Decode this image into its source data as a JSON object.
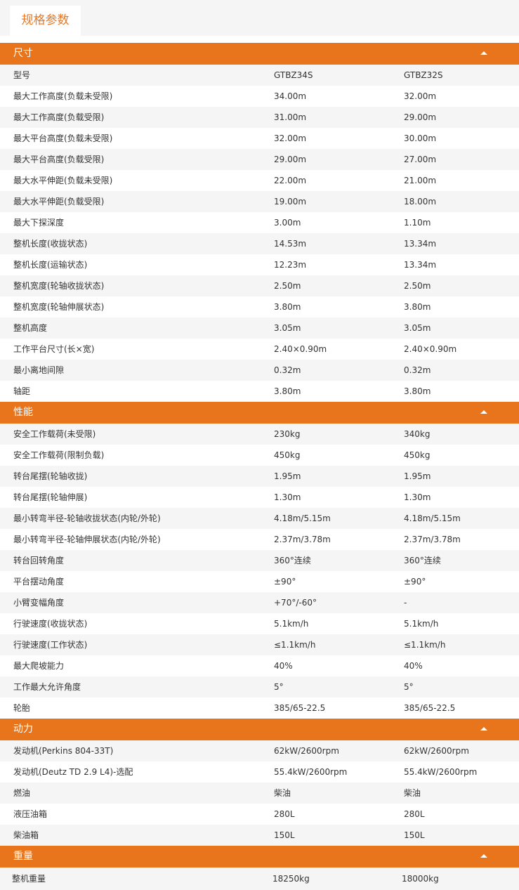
{
  "tab": {
    "label": "规格参数"
  },
  "sections": [
    {
      "title": "尺寸",
      "rows": [
        [
          "型号",
          "GTBZ34S",
          "GTBZ32S"
        ],
        [
          "最大工作高度(负载未受限)",
          "34.00m",
          "32.00m"
        ],
        [
          "最大工作高度(负载受限)",
          "31.00m",
          "29.00m"
        ],
        [
          "最大平台高度(负载未受限)",
          "32.00m",
          "30.00m"
        ],
        [
          "最大平台高度(负载受限)",
          "29.00m",
          "27.00m"
        ],
        [
          "最大水平伸距(负载未受限)",
          "22.00m",
          "21.00m"
        ],
        [
          "最大水平伸距(负载受限)",
          "19.00m",
          "18.00m"
        ],
        [
          "最大下探深度",
          "3.00m",
          "1.10m"
        ],
        [
          "整机长度(收拢状态)",
          "14.53m",
          "13.34m"
        ],
        [
          "整机长度(运输状态)",
          "12.23m",
          "13.34m"
        ],
        [
          "整机宽度(轮轴收拢状态)",
          "2.50m",
          "2.50m"
        ],
        [
          "整机宽度(轮轴伸展状态)",
          "3.80m",
          "3.80m"
        ],
        [
          "整机高度",
          "3.05m",
          "3.05m"
        ],
        [
          "工作平台尺寸(长×宽)",
          "2.40×0.90m",
          "2.40×0.90m"
        ],
        [
          "最小离地间隙",
          "0.32m",
          "0.32m"
        ],
        [
          "轴距",
          "3.80m",
          "3.80m"
        ]
      ]
    },
    {
      "title": "性能",
      "rows": [
        [
          "安全工作载荷(未受限)",
          "230kg",
          "340kg"
        ],
        [
          "安全工作载荷(限制负载)",
          "450kg",
          "450kg"
        ],
        [
          "转台尾摆(轮轴收拢)",
          "1.95m",
          "1.95m"
        ],
        [
          "转台尾摆(轮轴伸展)",
          "1.30m",
          "1.30m"
        ],
        [
          "最小转弯半径-轮轴收拢状态(内轮/外轮)",
          "4.18m/5.15m",
          "4.18m/5.15m"
        ],
        [
          "最小转弯半径-轮轴伸展状态(内轮/外轮)",
          "2.37m/3.78m",
          "2.37m/3.78m"
        ],
        [
          "转台回转角度",
          "360°连续",
          "360°连续"
        ],
        [
          "平台摆动角度",
          "±90°",
          "±90°"
        ],
        [
          "小臂变幅角度",
          "+70°/-60°",
          "-"
        ],
        [
          "行驶速度(收拢状态)",
          "5.1km/h",
          "5.1km/h"
        ],
        [
          "行驶速度(工作状态)",
          "≤1.1km/h",
          "≤1.1km/h"
        ],
        [
          "最大爬坡能力",
          "40%",
          "40%"
        ],
        [
          "工作最大允许角度",
          "5°",
          "5°"
        ],
        [
          "轮胎",
          "385/65-22.5",
          "385/65-22.5"
        ]
      ]
    },
    {
      "title": "动力",
      "rows": [
        [
          "发动机(Perkins 804-33T)",
          "62kW/2600rpm",
          "62kW/2600rpm"
        ],
        [
          "发动机(Deutz TD 2.9 L4)-选配",
          "55.4kW/2600rpm",
          "55.4kW/2600rpm"
        ],
        [
          "燃油",
          "柴油",
          "柴油"
        ],
        [
          "液压油箱",
          "280L",
          "280L"
        ],
        [
          "柴油箱",
          "150L",
          "150L"
        ]
      ]
    },
    {
      "title": "重量",
      "rows": [
        [
          "整机重量",
          "18250kg",
          "18000kg"
        ]
      ]
    }
  ]
}
